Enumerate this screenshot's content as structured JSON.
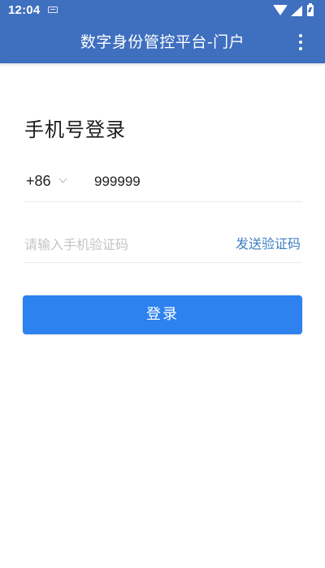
{
  "status_bar": {
    "time": "12:04",
    "icons": [
      "keyboard-icon",
      "wifi-icon",
      "signal-icon",
      "battery-charging-icon"
    ]
  },
  "app_bar": {
    "title": "数字身份管控平台-门户",
    "menu_icon": "more-vert-icon"
  },
  "login": {
    "heading": "手机号登录",
    "country_code": "+86",
    "phone_value": "999999",
    "code_placeholder": "请输入手机验证码",
    "code_value": "",
    "send_code_label": "发送验证码",
    "submit_label": "登录"
  },
  "colors": {
    "app_bar": "#3f6fbf",
    "primary_button": "#2d82ef",
    "link": "#3f7fc2"
  }
}
